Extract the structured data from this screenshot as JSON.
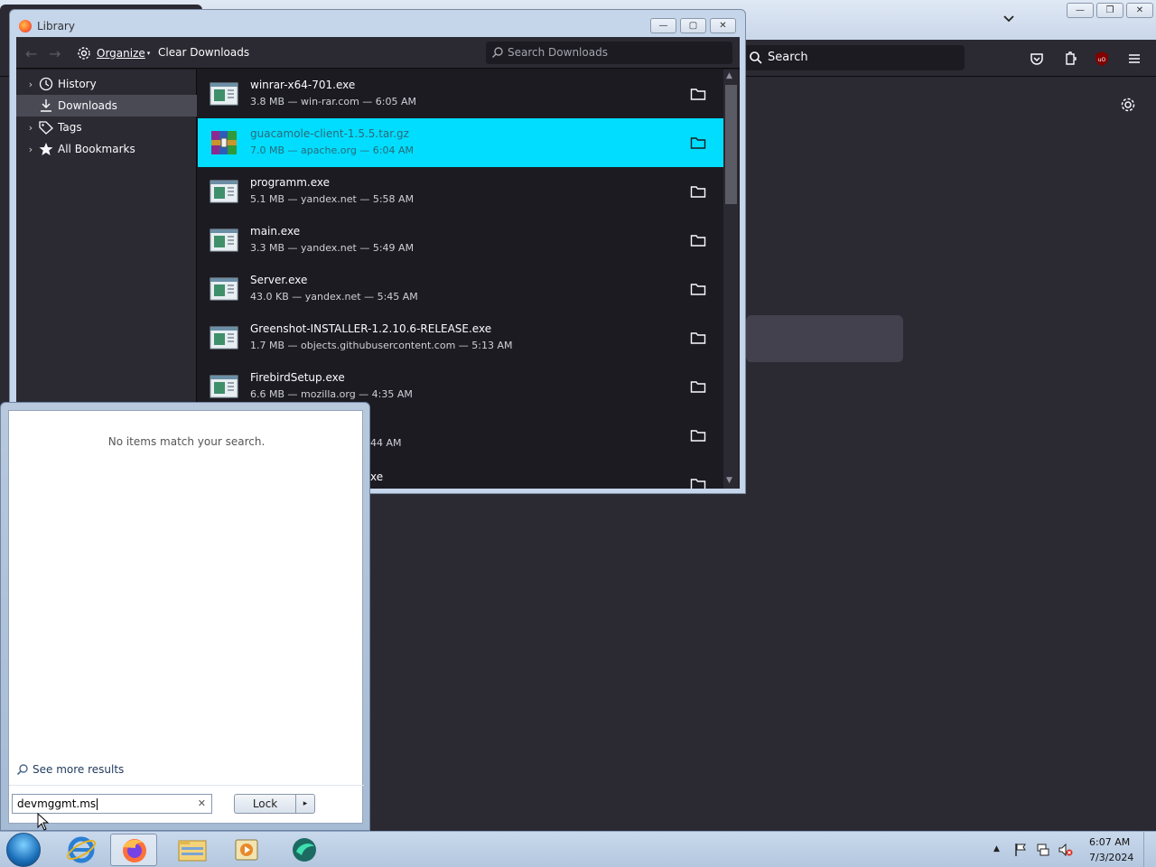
{
  "browser": {
    "search_placeholder": "Search"
  },
  "library": {
    "title": "Library",
    "organize_label": "Organize",
    "clear_downloads_label": "Clear Downloads",
    "search_placeholder": "Search Downloads",
    "sidebar": [
      {
        "label": "History",
        "icon": "clock-icon",
        "expandable": true
      },
      {
        "label": "Downloads",
        "icon": "download-icon",
        "expandable": false,
        "selected": true
      },
      {
        "label": "Tags",
        "icon": "tag-icon",
        "expandable": true
      },
      {
        "label": "All Bookmarks",
        "icon": "star-icon",
        "expandable": true
      }
    ],
    "downloads": [
      {
        "name": "winrar-x64-701.exe",
        "meta": "3.8 MB — win-rar.com — 6:05 AM"
      },
      {
        "name": "guacamole-client-1.5.5.tar.gz",
        "meta": "7.0 MB — apache.org — 6:04 AM",
        "selected": true
      },
      {
        "name": "programm.exe",
        "meta": "5.1 MB — yandex.net — 5:58 AM"
      },
      {
        "name": "main.exe",
        "meta": "3.3 MB — yandex.net — 5:49 AM"
      },
      {
        "name": "Server.exe",
        "meta": "43.0 KB — yandex.net — 5:45 AM"
      },
      {
        "name": "Greenshot-INSTALLER-1.2.10.6-RELEASE.exe",
        "meta": "1.7 MB — objects.githubusercontent.com — 5:13 AM"
      },
      {
        "name": "FirebirdSetup.exe",
        "meta": "6.6 MB — mozilla.org — 4:35 AM"
      },
      {
        "name": "",
        "meta": "44 AM"
      },
      {
        "name": "xe",
        "meta": ""
      }
    ]
  },
  "start_menu": {
    "no_items_text": "No items match your search.",
    "see_more_label": "See more results",
    "search_value": "devmggmt.ms",
    "lock_label": "Lock"
  },
  "taskbar": {
    "time": "6:07 AM",
    "date": "7/3/2024"
  },
  "colors": {
    "selection": "#00ddff",
    "dark_bg": "#1c1b22",
    "toolbar_bg": "#2b2a33"
  }
}
